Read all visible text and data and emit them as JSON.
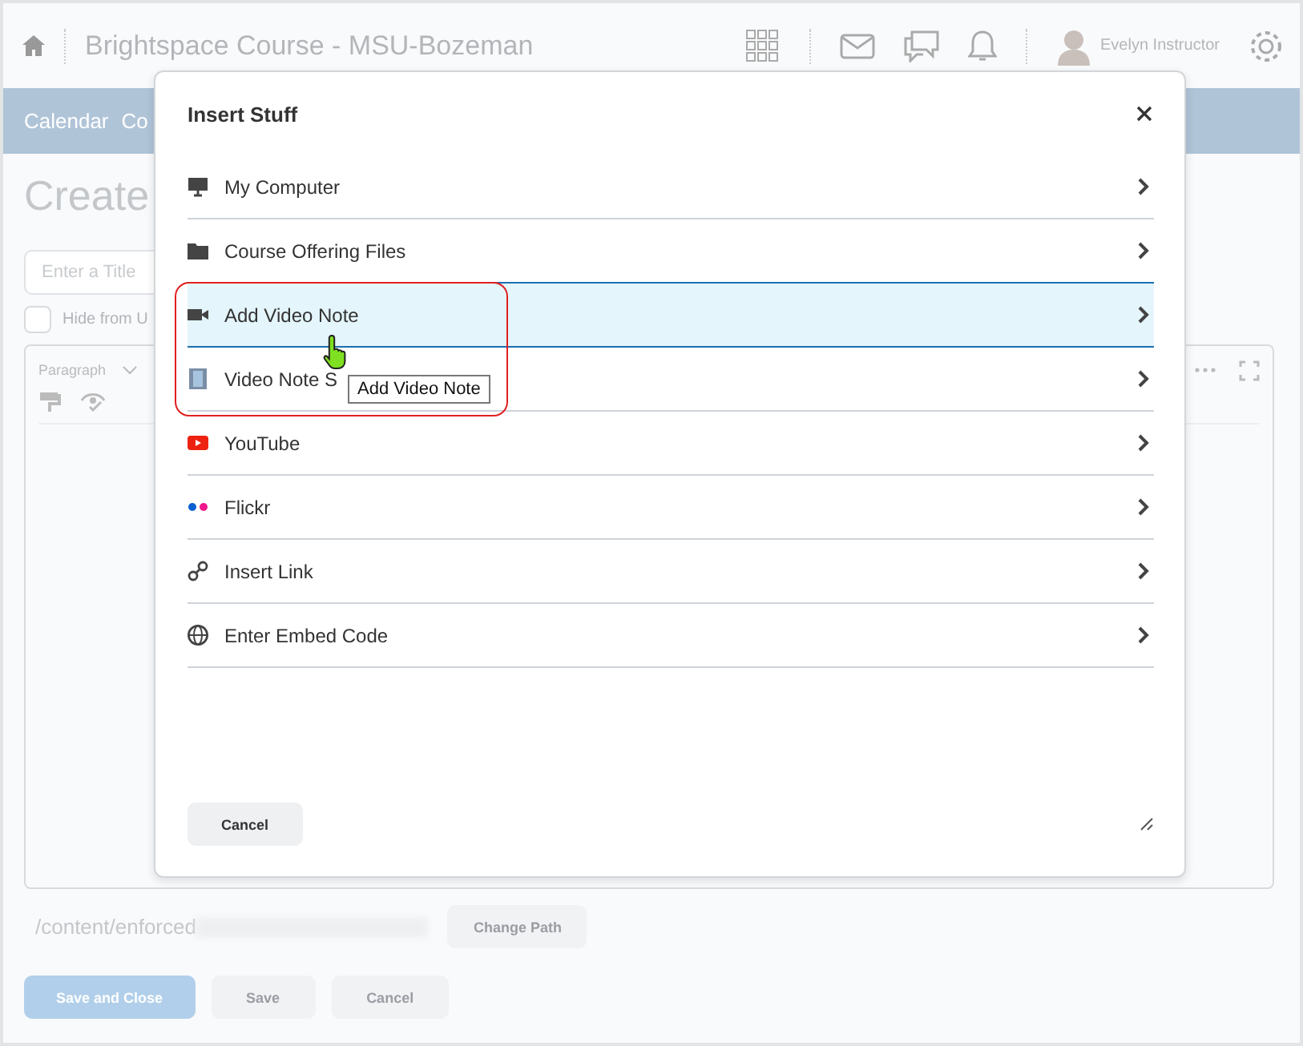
{
  "header": {
    "course_title": "Brightspace Course - MSU-Bozeman",
    "user_name": "Evelyn Instructor"
  },
  "nav": {
    "items": [
      "Calendar",
      "Co"
    ]
  },
  "page": {
    "heading": "Create",
    "title_field": {
      "placeholder": "Enter a Title"
    },
    "hide_checkbox": {
      "label": "Hide from U",
      "checked": false
    },
    "editor": {
      "format": "Paragraph"
    },
    "path": "/content/enforced",
    "change_path": "Change Path",
    "buttons": [
      {
        "label": "Save and Close",
        "kind": "primary"
      },
      {
        "label": "Save",
        "kind": "secondary"
      },
      {
        "label": "Cancel",
        "kind": "secondary"
      }
    ]
  },
  "dialog": {
    "title": "Insert Stuff",
    "items": [
      {
        "label": "My Computer",
        "kind": "computer",
        "highlighted": false
      },
      {
        "label": "Course Offering Files",
        "kind": "folder",
        "highlighted": false
      },
      {
        "label": "Add Video Note",
        "kind": "camera",
        "highlighted": true
      },
      {
        "label": "Video Note S",
        "kind": "film",
        "highlighted": false
      },
      {
        "label": "YouTube",
        "kind": "youtube",
        "highlighted": false
      },
      {
        "label": "Flickr",
        "kind": "flickr",
        "highlighted": false
      },
      {
        "label": "Insert Link",
        "kind": "link",
        "highlighted": false
      },
      {
        "label": "Enter Embed Code",
        "kind": "globe",
        "highlighted": false
      }
    ],
    "cancel": "Cancel",
    "tooltip": "Add Video Note"
  }
}
